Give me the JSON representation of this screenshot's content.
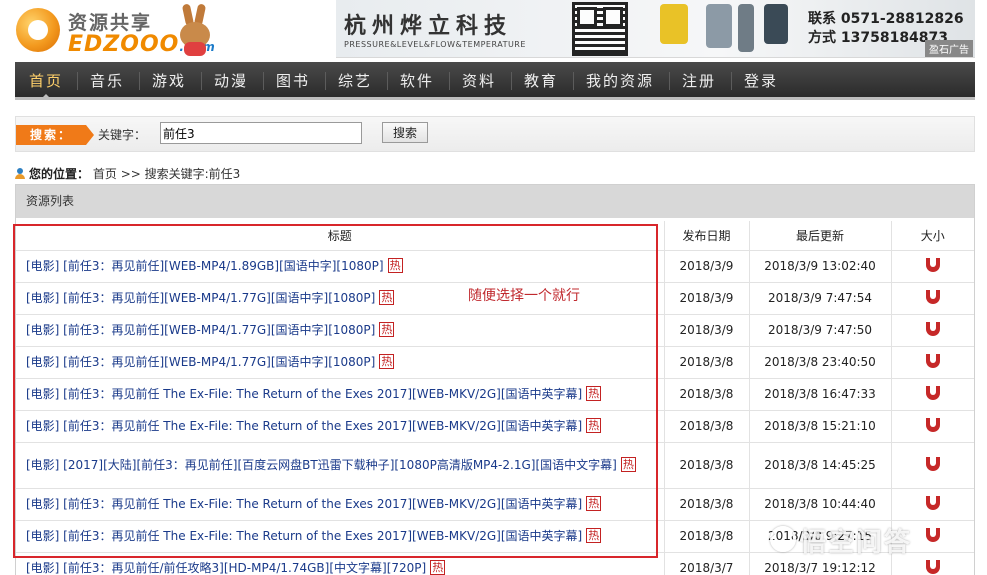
{
  "header": {
    "logo_cn": "资源共享",
    "logo_en": "EDZOOO",
    "logo_dom": ".com",
    "banner": {
      "title": "杭州烨立科技",
      "subtitle": "PRESSURE&LEVEL&FLOW&TEMPERATURE",
      "contact_line1": "联系 0571-28812826",
      "contact_line2": "方式 13758184873",
      "ad_tag": "盈石广告"
    }
  },
  "nav": {
    "items": [
      "首页",
      "音乐",
      "游戏",
      "动漫",
      "图书",
      "综艺",
      "软件",
      "资料",
      "教育",
      "我的资源",
      "注册",
      "登录"
    ],
    "active": "首页"
  },
  "search": {
    "tag": "搜索：",
    "label": "关键字：",
    "value": "前任3",
    "button": "搜索"
  },
  "breadcrumb": {
    "prefix": "您的位置：",
    "home": "首页",
    "sep": ">>",
    "current": "搜索关键字:前任3"
  },
  "list": {
    "heading": "资源列表",
    "columns": [
      "标题",
      "发布日期",
      "最后更新",
      "大小"
    ],
    "hot_label": "热",
    "rows": [
      {
        "title": "[电影] [前任3：再见前任][WEB-MP4/1.89GB][国语中字][1080P]",
        "date": "2018/3/9",
        "updated": "2018/3/9 13:02:40"
      },
      {
        "title": "[电影] [前任3：再见前任][WEB-MP4/1.77G][国语中字][1080P]",
        "date": "2018/3/9",
        "updated": "2018/3/9 7:47:54"
      },
      {
        "title": "[电影] [前任3：再见前任][WEB-MP4/1.77G][国语中字][1080P]",
        "date": "2018/3/9",
        "updated": "2018/3/9 7:47:50"
      },
      {
        "title": "[电影] [前任3：再见前任][WEB-MP4/1.77G][国语中字][1080P]",
        "date": "2018/3/8",
        "updated": "2018/3/8 23:40:50"
      },
      {
        "title": "[电影] [前任3：再见前任 The Ex-File: The Return of the Exes 2017][WEB-MKV/2G][国语中英字幕]",
        "date": "2018/3/8",
        "updated": "2018/3/8 16:47:33"
      },
      {
        "title": "[电影] [前任3：再见前任 The Ex-File: The Return of the Exes 2017][WEB-MKV/2G][国语中英字幕]",
        "date": "2018/3/8",
        "updated": "2018/3/8 15:21:10"
      },
      {
        "title": "[电影] [2017][大陆][前任3：再见前任][百度云网盘BT迅雷下载种子][1080P高清版MP4-2.1G][国语中文字幕]",
        "date": "2018/3/8",
        "updated": "2018/3/8 14:45:25"
      },
      {
        "title": "[电影] [前任3：再见前任 The Ex-File: The Return of the Exes 2017][WEB-MKV/2G][国语中英字幕]",
        "date": "2018/3/8",
        "updated": "2018/3/8 10:44:40"
      },
      {
        "title": "[电影] [前任3：再见前任 The Ex-File: The Return of the Exes 2017][WEB-MKV/2G][国语中英字幕]",
        "date": "2018/3/8",
        "updated": "2018/3/8 9:27:15"
      },
      {
        "title": "[电影] [前任3：再见前任/前任攻略3][HD-MP4/1.74GB][中文字幕][720P]",
        "date": "2018/3/7",
        "updated": "2018/3/7 19:12:12"
      }
    ]
  },
  "annotation": "随便选择一个就行",
  "watermark": "悟空问答",
  "colors": {
    "nav_bg": "#2b2b2b",
    "accent_orange": "#f07a18",
    "annotation_red": "#d8262b",
    "link_blue": "#1a3a8a"
  }
}
